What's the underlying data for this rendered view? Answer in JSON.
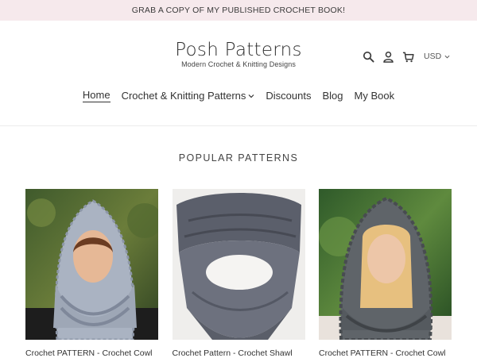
{
  "announcement": "GRAB A COPY OF MY PUBLISHED CROCHET BOOK!",
  "logo": {
    "title": "Posh Patterns",
    "subtitle": "Modern Crochet & Knitting Designs"
  },
  "header": {
    "icons": [
      "search-icon",
      "account-icon",
      "cart-icon"
    ],
    "currency": "USD"
  },
  "nav": {
    "items": [
      {
        "label": "Home",
        "active": true
      },
      {
        "label": "Crochet & Knitting Patterns",
        "dropdown": true
      },
      {
        "label": "Discounts"
      },
      {
        "label": "Blog"
      },
      {
        "label": "My Book"
      }
    ]
  },
  "section": {
    "title": "POPULAR PATTERNS"
  },
  "products": [
    {
      "title": "Crochet PATTERN - Crochet Cowl"
    },
    {
      "title": "Crochet Pattern - Crochet Shawl"
    },
    {
      "title": "Crochet PATTERN - Crochet Cowl"
    }
  ],
  "colors": {
    "announcement_bg": "#f6e9ec",
    "text": "#333333"
  }
}
